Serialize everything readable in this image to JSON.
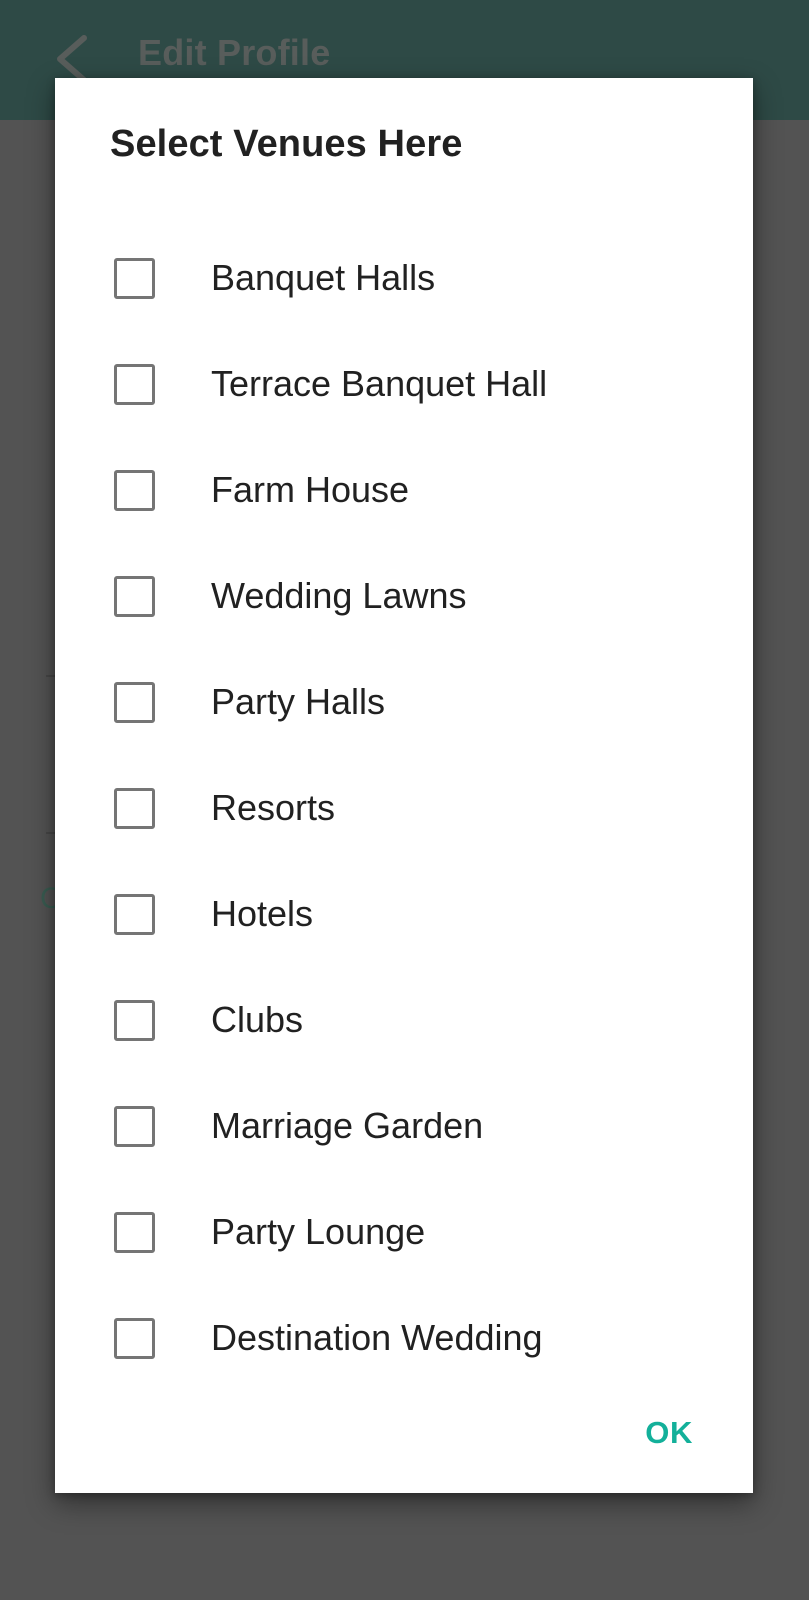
{
  "appbar": {
    "title": "Edit Profile",
    "back_icon": "chevron-left-icon",
    "background_color": "#014A40",
    "title_color": "#6F7B78"
  },
  "background_form": {
    "partial_label": "C"
  },
  "dialog": {
    "title": "Select Venues Here",
    "title_color": "#212121",
    "background_color": "#FFFFFF",
    "checkbox_border_color": "#757575",
    "options": [
      {
        "label": "Banquet Halls",
        "checked": false
      },
      {
        "label": "Terrace Banquet Hall",
        "checked": false
      },
      {
        "label": "Farm House",
        "checked": false
      },
      {
        "label": "Wedding Lawns",
        "checked": false
      },
      {
        "label": "Party Halls",
        "checked": false
      },
      {
        "label": "Resorts",
        "checked": false
      },
      {
        "label": "Hotels",
        "checked": false
      },
      {
        "label": "Clubs",
        "checked": false
      },
      {
        "label": "Marriage Garden",
        "checked": false
      },
      {
        "label": "Party Lounge",
        "checked": false
      },
      {
        "label": "Destination Wedding",
        "checked": false
      }
    ],
    "ok_label": "OK",
    "ok_color": "#13B09A"
  },
  "scrim": {
    "color": "#616161"
  }
}
